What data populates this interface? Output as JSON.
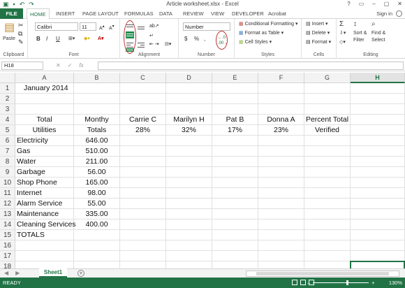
{
  "window": {
    "title": "Article worksheet.xlsx - Excel",
    "controls": [
      "?",
      "▭",
      "–",
      "▢",
      "✕"
    ]
  },
  "tabs": [
    "FILE",
    "HOME",
    "INSERT",
    "PAGE LAYOUT",
    "FORMULAS",
    "DATA",
    "REVIEW",
    "VIEW",
    "DEVELOPER",
    "Acrobat"
  ],
  "signin": "Sign in",
  "ribbon": {
    "clipboard": {
      "label": "Clipboard",
      "paste": "Paste"
    },
    "font": {
      "label": "Font",
      "name": "Calibri",
      "size": "11",
      "bold": "B",
      "italic": "I",
      "underline": "U"
    },
    "alignment": {
      "label": "Alignment"
    },
    "number": {
      "label": "Number",
      "format": "Number",
      "currency": "$",
      "percent": "%",
      "comma": ","
    },
    "styles": {
      "label": "Styles",
      "conditional": "Conditional Formatting",
      "format_table": "Format as Table",
      "cell_styles": "Cell Styles"
    },
    "cells": {
      "label": "Cells",
      "insert": "Insert",
      "delete": "Delete",
      "format": "Format"
    },
    "editing": {
      "label": "Editing",
      "sum": "Σ",
      "sort": "Sort &",
      "sort2": "Filter",
      "find": "Find &",
      "find2": "Select"
    }
  },
  "formula_bar": {
    "name_box": "H18",
    "fx": "fx",
    "value": ""
  },
  "columns": [
    "A",
    "B",
    "C",
    "D",
    "E",
    "F",
    "G",
    "H"
  ],
  "selected_column": "H",
  "rows": [
    "1",
    "2",
    "3",
    "4",
    "5",
    "6",
    "7",
    "8",
    "9",
    "10",
    "11",
    "12",
    "13",
    "14",
    "15",
    "16",
    "17",
    "18"
  ],
  "cells": {
    "A1": "January 2014",
    "A4": "Total",
    "B4": "Monthy",
    "C4": "Carrie C",
    "D4": "Marilyn H",
    "E4": "Pat B",
    "F4": "Donna A",
    "G4": "Percent Total",
    "A5": "Utilities",
    "B5": "Totals",
    "C5": "28%",
    "D5": "32%",
    "E5": "17%",
    "F5": "23%",
    "G5": "Verified",
    "A6": "Electricity",
    "B6": "646.00",
    "A7": "Gas",
    "B7": "510.00",
    "A8": "Water",
    "B8": "211.00",
    "A9": "Garbage",
    "B9": "56.00",
    "A10": "Shop Phone",
    "B10": "165.00",
    "A11": "Internet",
    "B11": "98.00",
    "A12": "Alarm Service",
    "B12": "55.00",
    "A13": "Maintenance",
    "B13": "335.00",
    "A14": "Cleaning Services",
    "B14": "400.00",
    "A15": "TOTALS"
  },
  "sheets": [
    "Sheet1"
  ],
  "status": {
    "mode": "READY",
    "zoom": "130%",
    "zoom_fraction": 0.6
  },
  "colors": {
    "accent": "#217346",
    "annotation": "#b8342d"
  }
}
